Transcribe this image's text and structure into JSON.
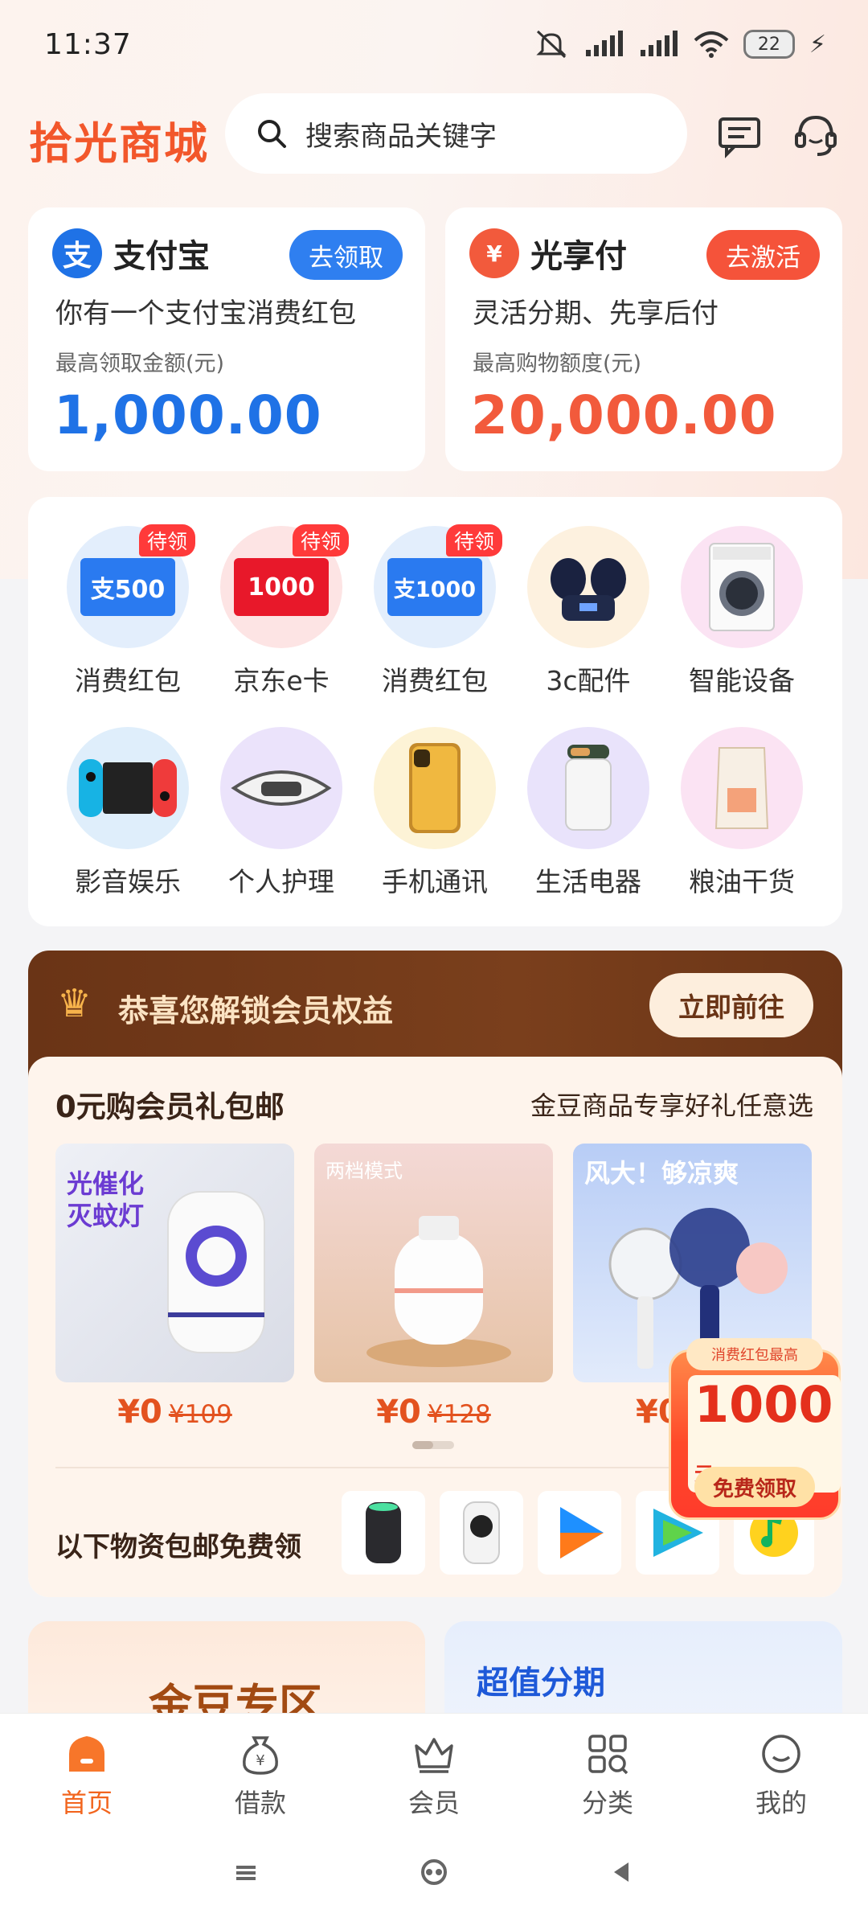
{
  "status_bar": {
    "time": "11:37",
    "battery": "22"
  },
  "header": {
    "logo": "拾光商城",
    "search_placeholder": "搜索商品关键字"
  },
  "promo_cards": [
    {
      "brand": "支付宝",
      "brand_glyph": "支",
      "button": "去领取",
      "desc": "你有一个支付宝消费红包",
      "sub": "最高领取金额(元)",
      "amount": "1,000.00",
      "color": "#1f72e6"
    },
    {
      "brand": "光享付",
      "brand_glyph": "¥",
      "button": "去激活",
      "desc": "灵活分期、先享后付",
      "sub": "最高购物额度(元)",
      "amount": "20,000.00",
      "color": "#f25a3c"
    }
  ],
  "categories": [
    {
      "label": "消费红包",
      "badge": "待领",
      "card_text": "支500"
    },
    {
      "label": "京东e卡",
      "badge": "待领",
      "card_text": "1000"
    },
    {
      "label": "消费红包",
      "badge": "待领",
      "card_text": "支1000"
    },
    {
      "label": "3c配件"
    },
    {
      "label": "智能设备"
    },
    {
      "label": "影音娱乐"
    },
    {
      "label": "个人护理"
    },
    {
      "label": "手机通讯"
    },
    {
      "label": "生活电器"
    },
    {
      "label": "粮油干货"
    }
  ],
  "member": {
    "title": "恭喜您解锁会员权益",
    "button": "立即前往",
    "panel_title": "0元购会员礼包邮",
    "panel_right": "金豆商品专享好礼任意选",
    "products": [
      {
        "overlay": "光催化\n灭蚊灯",
        "price": "¥0",
        "orig": "¥109"
      },
      {
        "overlay": "两档模式",
        "price": "¥0",
        "orig": "¥128"
      },
      {
        "overlay": "风大！够凉爽",
        "price": "¥0",
        "orig": ""
      }
    ],
    "free_label": "以下物资包邮免费领"
  },
  "float_coupon": {
    "top": "消费红包最高",
    "amount": "1000",
    "unit": "元",
    "cta": "免费领取"
  },
  "bottom_cards": {
    "left": "金豆专区",
    "right": "超值分期"
  },
  "tabs": [
    {
      "label": "首页",
      "active": true
    },
    {
      "label": "借款"
    },
    {
      "label": "会员"
    },
    {
      "label": "分类"
    },
    {
      "label": "我的"
    }
  ],
  "colors": {
    "accent": "#f2651e",
    "brand_blue": "#1f72e6",
    "brand_red": "#f25a3c",
    "member_brown": "#6a3416"
  }
}
